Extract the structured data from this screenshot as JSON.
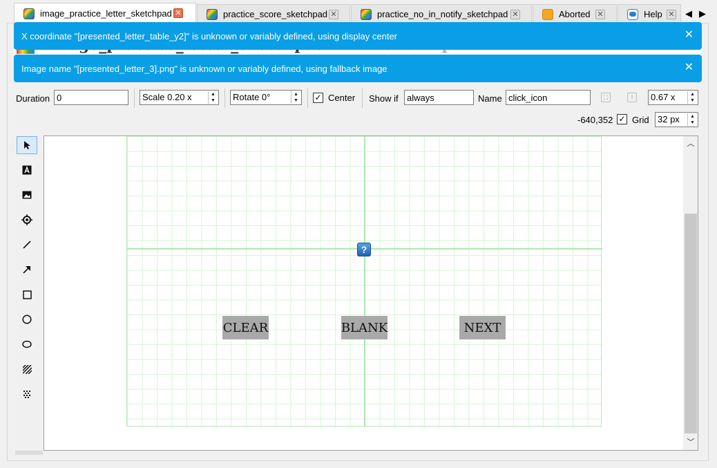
{
  "tabs": [
    {
      "label": "image_practice_letter_sketchpad",
      "icon": "rainbow-app-icon",
      "active": true
    },
    {
      "label": "practice_score_sketchpad",
      "icon": "rainbow-app-icon"
    },
    {
      "label": "practice_no_in_notify_sketchpad",
      "icon": "rainbow-app-icon"
    },
    {
      "label": "Aborted",
      "icon": "orange-square-icon"
    },
    {
      "label": "Help",
      "icon": "help-cloud-icon"
    }
  ],
  "tab_close_glyph": "✕",
  "tab_scroll": {
    "left": "◀",
    "right": "▶"
  },
  "header": {
    "title": "image_practice_letter_sketchpad",
    "subtitle": "- Sketchpad"
  },
  "notifications": [
    {
      "text": "X coordinate \"[presented_letter_table_y2]\" is unknown or variably defined, using display center"
    },
    {
      "text": "Image name \"[presented_letter_3].png\" is unknown or variably defined, using fallback image"
    }
  ],
  "notification_close": "✕",
  "toolbar": {
    "duration_label": "Duration",
    "duration_value": "0",
    "scale_value": "Scale 0.20 x",
    "rotate_value": "Rotate 0°",
    "center_label": "Center",
    "center_checked": "✓",
    "show_if_label": "Show if",
    "show_if_value": "always",
    "name_label": "Name",
    "name_value": "click_icon",
    "zoom_value": "0.67 x",
    "coords": "-640,352",
    "grid_label": "Grid",
    "grid_checked": "✓",
    "grid_size": "32 px"
  },
  "tools": [
    {
      "name": "select-tool",
      "icon": "arrow-pointer-icon"
    },
    {
      "name": "text-tool",
      "icon": "text-a-icon"
    },
    {
      "name": "image-tool",
      "icon": "image-icon"
    },
    {
      "name": "fixdot-tool",
      "icon": "fixdot-icon"
    },
    {
      "name": "line-tool",
      "icon": "line-icon"
    },
    {
      "name": "arrow-tool",
      "icon": "arrow-diagonal-icon"
    },
    {
      "name": "rect-tool",
      "icon": "rectangle-icon"
    },
    {
      "name": "circle-tool",
      "icon": "circle-icon"
    },
    {
      "name": "ellipse-tool",
      "icon": "ellipse-icon"
    },
    {
      "name": "gabor-tool",
      "icon": "gabor-patch-icon"
    },
    {
      "name": "noise-tool",
      "icon": "noise-patch-icon"
    }
  ],
  "canvas": {
    "buttons": [
      "CLEAR",
      "BLANK",
      "NEXT"
    ],
    "question_icon_text": "?",
    "grid_color": "#d6f5d6",
    "button_color": "#a9a9a9"
  },
  "colors": {
    "notification": "#0a9ee6",
    "tab_close_active": "#e5734d"
  }
}
